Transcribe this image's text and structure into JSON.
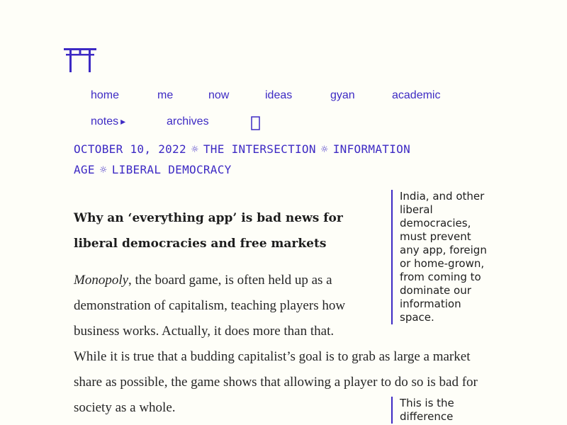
{
  "logo": {
    "icon": "torii-gate-icon",
    "color": "#3d2ac4"
  },
  "nav": {
    "row1": [
      "home",
      "me",
      "now",
      "ideas",
      "gyan",
      "academic"
    ],
    "notes": "notes",
    "notes_arrow": "▸",
    "archives": "archives",
    "search_icon": "search-icon"
  },
  "meta": {
    "date": "OCTOBER 10, 2022",
    "separator": "☼",
    "tags": [
      "THE INTERSECTION",
      "INFORMATION AGE",
      "LIBERAL DEMOCRACY"
    ]
  },
  "article": {
    "title": "Why an ‘everything app’ is bad news for liberal democracies and free markets",
    "para1_italic": "Monopoly",
    "para1_line1_rest": ", the board game, is often held up as a",
    "para1_line2": "demonstration of capitalism, teaching players how",
    "para1_line3": "business works. Actually, it does more than that.",
    "para1_rest": "While it is true that a budding capitalist’s goal is to grab as large a market share as possible, the game shows that allowing a player to do so is bad for society as a whole."
  },
  "sidenotes": [
    "India, and other liberal democracies, must prevent any app, foreign or home-grown, from coming to dominate our information space.",
    "This is the difference"
  ],
  "colors": {
    "accent": "#3d2ac4",
    "background": "#fefef8",
    "text": "#262626"
  }
}
